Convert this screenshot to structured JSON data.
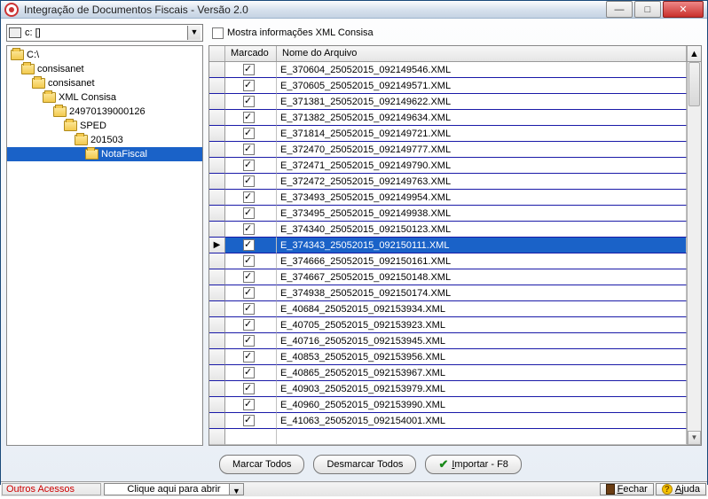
{
  "window": {
    "title": "Integração de Documentos Fiscais  - Versão 2.0"
  },
  "drive": {
    "text": "c: []"
  },
  "showXml": {
    "label": "Mostra informações XML Consisa",
    "checked": false
  },
  "tree": {
    "items": [
      {
        "label": "C:\\",
        "indent": 0,
        "selected": false
      },
      {
        "label": "consisanet",
        "indent": 1,
        "selected": false
      },
      {
        "label": "consisanet",
        "indent": 2,
        "selected": false
      },
      {
        "label": "XML Consisa",
        "indent": 3,
        "selected": false
      },
      {
        "label": "24970139000126",
        "indent": 4,
        "selected": false
      },
      {
        "label": "SPED",
        "indent": 5,
        "selected": false
      },
      {
        "label": "201503",
        "indent": 6,
        "selected": false
      },
      {
        "label": "NotaFiscal",
        "indent": 7,
        "selected": true
      }
    ]
  },
  "grid": {
    "headers": {
      "marcado": "Marcado",
      "nome": "Nome do Arquivo"
    },
    "rows": [
      {
        "checked": true,
        "name": "E_370604_25052015_092149546.XML",
        "current": false
      },
      {
        "checked": true,
        "name": "E_370605_25052015_092149571.XML",
        "current": false
      },
      {
        "checked": true,
        "name": "E_371381_25052015_092149622.XML",
        "current": false
      },
      {
        "checked": true,
        "name": "E_371382_25052015_092149634.XML",
        "current": false
      },
      {
        "checked": true,
        "name": "E_371814_25052015_092149721.XML",
        "current": false
      },
      {
        "checked": true,
        "name": "E_372470_25052015_092149777.XML",
        "current": false
      },
      {
        "checked": true,
        "name": "E_372471_25052015_092149790.XML",
        "current": false
      },
      {
        "checked": true,
        "name": "E_372472_25052015_092149763.XML",
        "current": false
      },
      {
        "checked": true,
        "name": "E_373493_25052015_092149954.XML",
        "current": false
      },
      {
        "checked": true,
        "name": "E_373495_25052015_092149938.XML",
        "current": false
      },
      {
        "checked": true,
        "name": "E_374340_25052015_092150123.XML",
        "current": false
      },
      {
        "checked": true,
        "name": "E_374343_25052015_092150111.XML",
        "current": true
      },
      {
        "checked": true,
        "name": "E_374666_25052015_092150161.XML",
        "current": false
      },
      {
        "checked": true,
        "name": "E_374667_25052015_092150148.XML",
        "current": false
      },
      {
        "checked": true,
        "name": "E_374938_25052015_092150174.XML",
        "current": false
      },
      {
        "checked": true,
        "name": "E_40684_25052015_092153934.XML",
        "current": false
      },
      {
        "checked": true,
        "name": "E_40705_25052015_092153923.XML",
        "current": false
      },
      {
        "checked": true,
        "name": "E_40716_25052015_092153945.XML",
        "current": false
      },
      {
        "checked": true,
        "name": "E_40853_25052015_092153956.XML",
        "current": false
      },
      {
        "checked": true,
        "name": "E_40865_25052015_092153967.XML",
        "current": false
      },
      {
        "checked": true,
        "name": "E_40903_25052015_092153979.XML",
        "current": false
      },
      {
        "checked": true,
        "name": "E_40960_25052015_092153990.XML",
        "current": false
      },
      {
        "checked": true,
        "name": "E_41063_25052015_092154001.XML",
        "current": false
      }
    ]
  },
  "buttons": {
    "marcarTodos": "Marcar Todos",
    "desmarcarTodos": "Desmarcar Todos",
    "importar": "Importar - F8"
  },
  "bottom": {
    "outrosAcessos": "Outros Acessos",
    "comboPlaceholder": "Clique aqui para abrir",
    "fechar": "Fechar",
    "ajuda": "Ajuda"
  }
}
